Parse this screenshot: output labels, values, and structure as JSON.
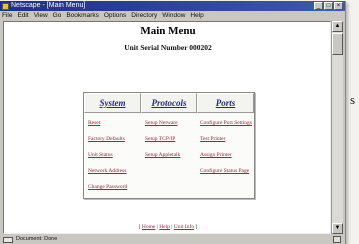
{
  "window": {
    "title": "Netscape - [Main Menu]",
    "controls": [
      "_",
      "□",
      "×"
    ]
  },
  "menubar": [
    "File",
    "Edit",
    "View",
    "Go",
    "Bookmarks",
    "Options",
    "Directory",
    "Window",
    "Help"
  ],
  "page": {
    "title": "Main Menu",
    "subtitle": "Unit Serial Number 000202",
    "columns": [
      {
        "header": "System",
        "links": [
          "Reset",
          "Factory Defaults",
          "Unit Status",
          "Network Address",
          "Change Password"
        ]
      },
      {
        "header": "Protocols",
        "links": [
          "Setup Netware",
          "Setup TCP/IP",
          "Setup Appletalk"
        ]
      },
      {
        "header": "Ports",
        "links": [
          "Configure Port Settings",
          "Test Printer",
          "Assign Printer",
          "Configure Status Page"
        ]
      }
    ],
    "footer": {
      "open": "[",
      "links": [
        "Home",
        "Help",
        "Unit Info"
      ],
      "close": "]"
    }
  },
  "statusbar": {
    "text": "Document: Done"
  },
  "outside_text": "s",
  "colors": {
    "titlebar": "#1f2f86",
    "link": "#a0243c",
    "header_link": "#2a2a7a"
  }
}
